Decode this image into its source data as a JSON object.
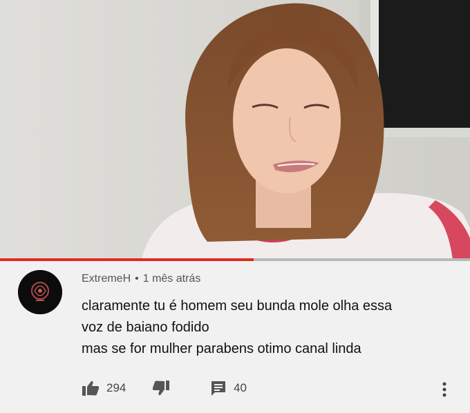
{
  "video": {
    "progress_fraction": 0.54
  },
  "comment": {
    "author": "ExtremeH",
    "separator": "•",
    "time": "1 mês atrás",
    "lines": [
      "claramente tu é homem seu bunda mole olha essa",
      "voz de baiano fodido",
      "mas se for mulher parabens otimo canal linda"
    ],
    "likes": "294",
    "replies": "40"
  },
  "icons": {
    "like": "thumbs-up-icon",
    "dislike": "thumbs-down-icon",
    "reply": "reply-icon",
    "more": "more-vert-icon"
  },
  "colors": {
    "progress": "#e02a1f",
    "background": "#f1f1f1",
    "text": "#111111"
  }
}
